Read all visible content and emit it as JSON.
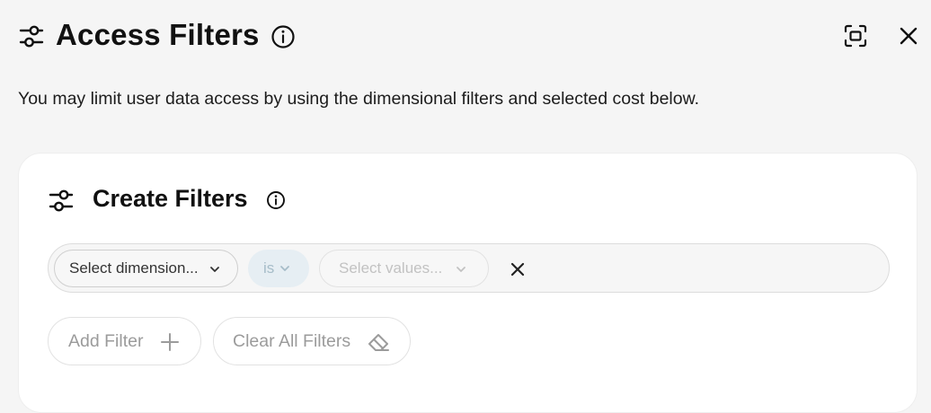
{
  "header": {
    "title": "Access Filters",
    "icons": {
      "title_icon": "filters-icon",
      "info": "info-icon",
      "fullscreen": "fullscreen-icon",
      "close": "close-icon"
    }
  },
  "description": "You may limit user data access by using the dimensional filters and selected cost below.",
  "card": {
    "title": "Create Filters",
    "icons": {
      "title_icon": "filters-icon",
      "info": "info-icon"
    },
    "filter_row": {
      "dimension_label": "Select dimension...",
      "operator_label": "is",
      "values_label": "Select values...",
      "remove_icon": "close-icon"
    },
    "actions": {
      "add_filter": "Add Filter",
      "clear_all": "Clear All Filters"
    }
  },
  "colors": {
    "background": "#f5f5f5",
    "card": "#ffffff",
    "operator_pill": "#e6eef3",
    "muted_text": "#9b9b9b"
  }
}
